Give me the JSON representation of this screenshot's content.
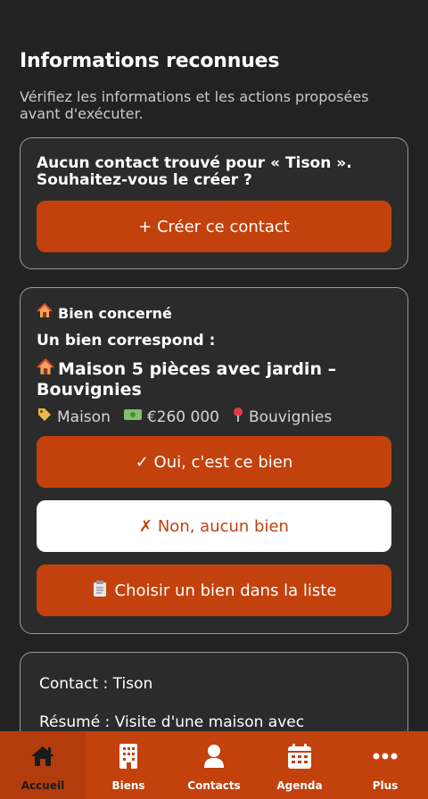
{
  "header": {
    "title": "Informations reconnues",
    "subtitle": "Vérifiez les informations et les actions proposées avant d'exécuter."
  },
  "contact_card": {
    "question": "Aucun contact trouvé pour «  Tison ». Souhaitez-vous le créer ?",
    "create_button": "+ Créer ce contact"
  },
  "property_card": {
    "section_label": "Bien concerné",
    "match_label": "Un bien correspond :",
    "property_title": "Maison 5 pièces avec jardin – Bouvignies",
    "type": "Maison",
    "price": "€260 000",
    "location": "Bouvignies",
    "confirm_button": "✓ Oui, c'est ce bien",
    "reject_button": "✗ Non, aucun bien",
    "choose_button": "Choisir un bien dans la liste"
  },
  "summary_card": {
    "contact_line": "Contact :  Tison",
    "summary_line": "Résumé : Visite d'une maison avec"
  },
  "bottom_nav": {
    "items": [
      {
        "label": "Accueil",
        "icon": "home-icon",
        "active": true
      },
      {
        "label": "Biens",
        "icon": "building-icon",
        "active": false
      },
      {
        "label": "Contacts",
        "icon": "user-icon",
        "active": false
      },
      {
        "label": "Agenda",
        "icon": "calendar-icon",
        "active": false
      },
      {
        "label": "Plus",
        "icon": "more-icon",
        "active": false
      }
    ]
  },
  "colors": {
    "background": "#222222",
    "card": "#2b2b2b",
    "accent": "#c2410c",
    "nav_active": "#b23c0b"
  }
}
